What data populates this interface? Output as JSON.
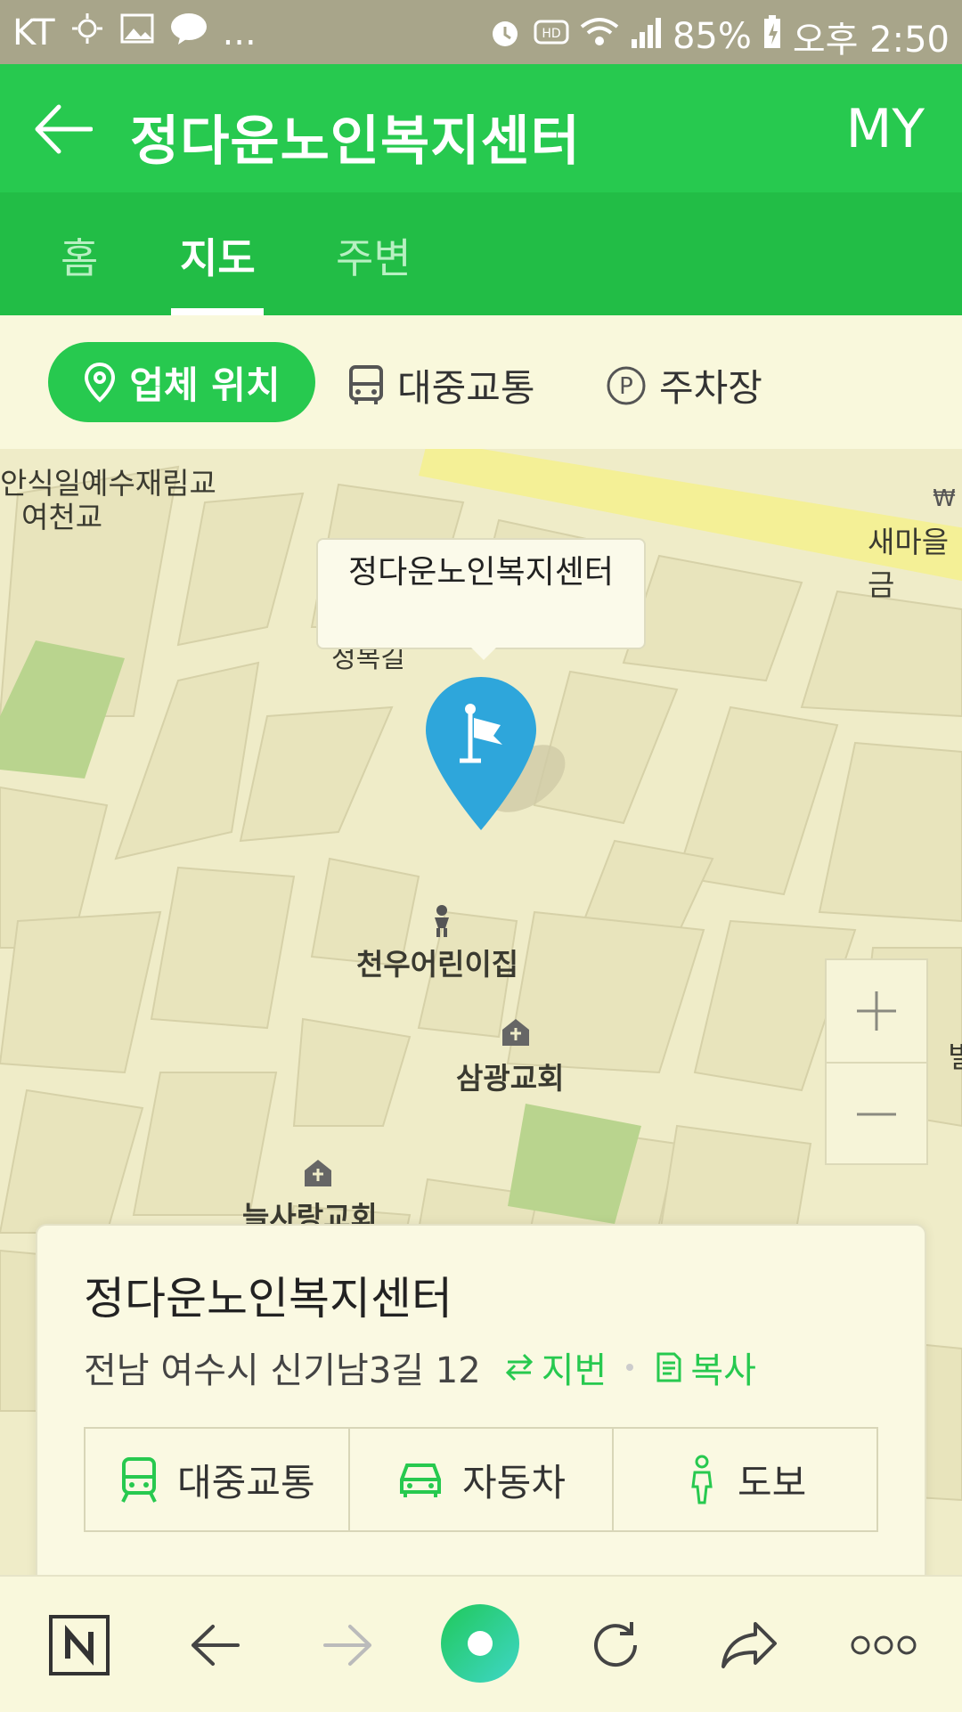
{
  "status_bar": {
    "carrier": "KT",
    "more": "...",
    "battery": "85%",
    "time": "오후 2:50"
  },
  "header": {
    "title": "정다운노인복지센터",
    "my_label": "MY"
  },
  "tabs": [
    {
      "label": "홈",
      "active": false
    },
    {
      "label": "지도",
      "active": true
    },
    {
      "label": "주변",
      "active": false
    }
  ],
  "filters": [
    {
      "label": "업체 위치",
      "active": true,
      "icon": "location-pin-icon"
    },
    {
      "label": "대중교통",
      "active": false,
      "icon": "bus-icon"
    },
    {
      "label": "주차장",
      "active": false,
      "icon": "parking-icon"
    }
  ],
  "map": {
    "callout": "정다운노인복지센터",
    "labels": [
      "안식일예수재림교",
      "여천교",
      "새마을금",
      "정복길",
      "천우어린이집",
      "삼광교회",
      "늘사랑교회",
      "빌"
    ],
    "zoom_in": "+",
    "zoom_out": "—"
  },
  "card": {
    "name": "정다운노인복지센터",
    "address": "전남 여수시 신기남3길 12",
    "jibun_label": "지번",
    "copy_label": "복사",
    "actions": [
      {
        "label": "대중교통",
        "icon": "subway-icon"
      },
      {
        "label": "자동차",
        "icon": "car-icon"
      },
      {
        "label": "도보",
        "icon": "walking-icon"
      }
    ]
  },
  "colors": {
    "accent": "#27c94f",
    "marker": "#2ea6db",
    "map_bg": "#efecc8"
  }
}
